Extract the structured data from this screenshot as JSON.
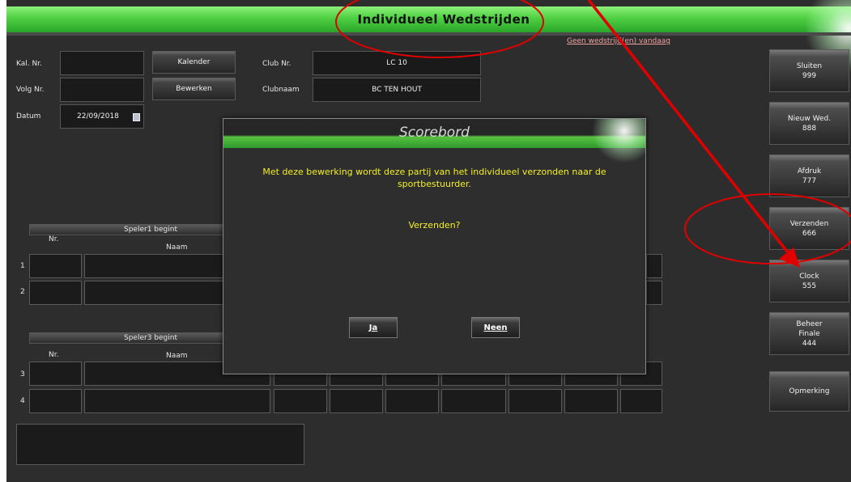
{
  "header": {
    "title": "Individueel Wedstrijden",
    "no_match_text": "Geen wedstrijd(en) vandaag"
  },
  "form": {
    "kal_nr_label": "Kal. Nr.",
    "volg_nr_label": "Volg Nr.",
    "datum_label": "Datum",
    "datum_value": "22/09/2018",
    "club_nr_label": "Club Nr.",
    "club_nr_value": "LC 10",
    "clubnaam_label": "Clubnaam",
    "clubnaam_value": "BC TEN HOUT",
    "kalender_button": "Kalender",
    "bewerken_button": "Bewerken"
  },
  "groups": [
    {
      "header": "Speler1 begint",
      "col_nr": "Nr.",
      "col_naam": "Naam",
      "rows": [
        "1",
        "2"
      ]
    },
    {
      "header": "Speler3 begint",
      "col_nr": "Nr.",
      "col_naam": "Naam",
      "rows": [
        "3",
        "4"
      ]
    }
  ],
  "sidebar": [
    {
      "label": "Sluiten\n999"
    },
    {
      "label": "Nieuw Wed.\n888"
    },
    {
      "label": "Afdruk\n777"
    },
    {
      "label": "Verzenden\n666"
    },
    {
      "label": "Clock\n555"
    },
    {
      "label": "Beheer\nFinale\n444"
    },
    {
      "label": "Opmerking"
    }
  ],
  "dialog": {
    "title": "Scorebord",
    "message": "Met deze bewerking wordt deze partij van het individueel verzonden naar de sportbestuurder.",
    "question": "Verzenden?",
    "yes_button": "Ja",
    "no_button": "Neen"
  },
  "colors": {
    "accent_green": "#4fd043",
    "annotation_red": "#e00000",
    "message_yellow": "#f4f024"
  }
}
